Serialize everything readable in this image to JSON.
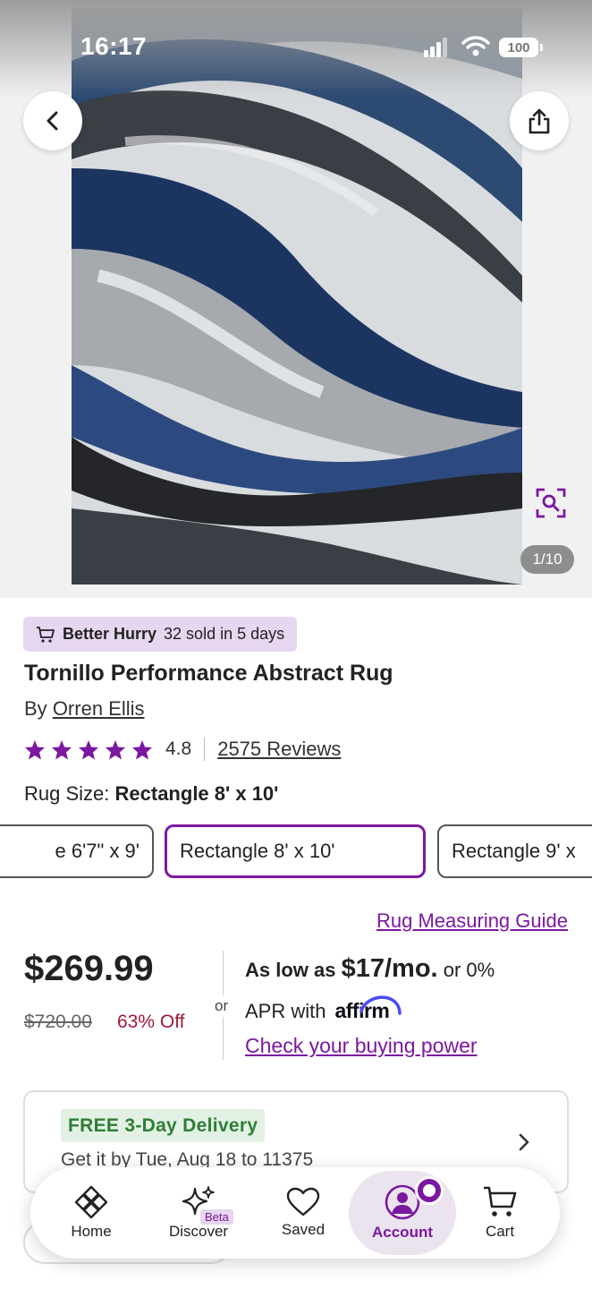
{
  "status_bar": {
    "time": "16:17",
    "battery": "100"
  },
  "gallery": {
    "counter": "1/10"
  },
  "urgency": {
    "label": "Better Hurry",
    "detail": "32 sold in 5 days"
  },
  "product": {
    "title": "Tornillo Performance Abstract Rug",
    "by_prefix": "By",
    "brand": "Orren Ellis",
    "rating": "4.8",
    "stars": 5,
    "reviews": "2575 Reviews"
  },
  "size": {
    "label": "Rug Size:",
    "selected": "Rectangle 8' x 10'",
    "options": [
      "e 6'7\" x 9'",
      "Rectangle 8' x 10'",
      "Rectangle 9' x"
    ]
  },
  "pricing": {
    "guide_link": "Rug Measuring Guide",
    "price": "$269.99",
    "original_price": "$720.00",
    "discount": "63% Off",
    "or": "or",
    "as_low_as": "As low as",
    "monthly": "$17/mo.",
    "apr_prefix": "or 0%",
    "apr_with": "APR with",
    "affirm": "affirm",
    "buying_power": "Check your buying power"
  },
  "delivery": {
    "badge": "FREE 3-Day Delivery",
    "date": "Get it by Tue, Aug 18 to 11375"
  },
  "nav": {
    "home": "Home",
    "discover": "Discover",
    "beta": "Beta",
    "saved": "Saved",
    "account": "Account",
    "cart": "Cart"
  },
  "colors": {
    "brand_purple": "#7b189f",
    "discount_red": "#a0183a",
    "delivery_green": "#2f7d35",
    "star": "#7b189f"
  }
}
